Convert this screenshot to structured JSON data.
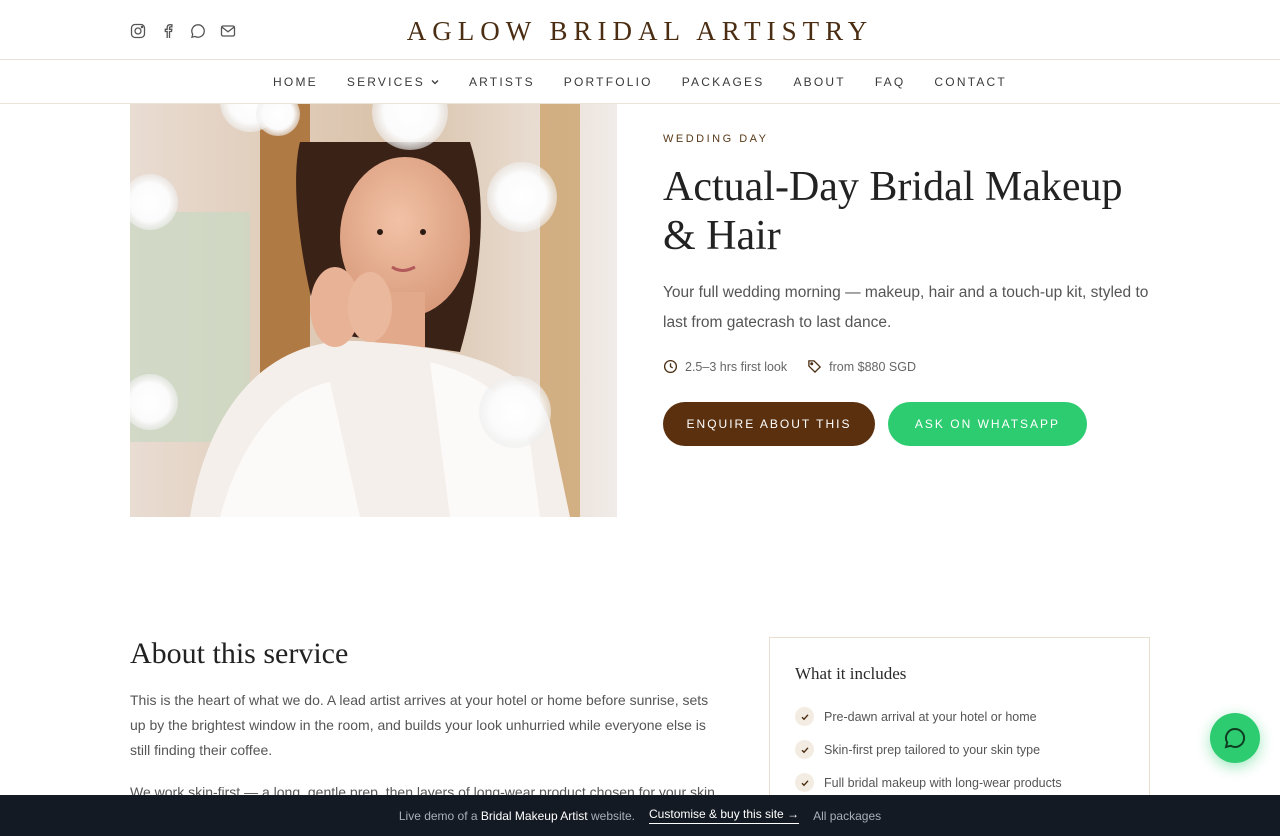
{
  "brand": {
    "name": "AGLOW BRIDAL ARTISTRY"
  },
  "socials": [
    "instagram-icon",
    "facebook-icon",
    "whatsapp-icon",
    "mail-icon"
  ],
  "nav": {
    "items": [
      {
        "label": "HOME"
      },
      {
        "label": "SERVICES"
      },
      {
        "label": "ARTISTS"
      },
      {
        "label": "PORTFOLIO"
      },
      {
        "label": "PACKAGES"
      },
      {
        "label": "ABOUT"
      },
      {
        "label": "FAQ"
      },
      {
        "label": "CONTACT"
      }
    ]
  },
  "hero": {
    "eyebrow": "WEDDING DAY",
    "title": "Actual-Day Bridal Makeup & Hair",
    "description": "Your full wedding morning — makeup, hair and a touch-up kit, styled to last from gatecrash to last dance.",
    "duration": "2.5–3 hrs first look",
    "price": "from $880 SGD",
    "enquire_label": "ENQUIRE ABOUT THIS",
    "whatsapp_label": "ASK ON WHATSAPP"
  },
  "about": {
    "heading": "About this service",
    "p1": "This is the heart of what we do. A lead artist arrives at your hotel or home before sunrise, sets up by the brightest window in the room, and builds your look unhurried while everyone else is still finding their coffee.",
    "p2": "We work skin-first — a long, gentle prep, then layers of long-wear product chosen for your skin type"
  },
  "includes": {
    "heading": "What it includes",
    "items": [
      "Pre-dawn arrival at your hotel or home",
      "Skin-first prep tailored to your skin type",
      "Full bridal makeup with long-wear products"
    ]
  },
  "demo_bar": {
    "prefix": "Live demo of a",
    "site_type": "Bridal Makeup Artist",
    "suffix": "website.",
    "customise_label": "Customise & buy this site →",
    "packages_label": "All packages"
  },
  "colors": {
    "brand_brown": "#5a300f",
    "whatsapp_green": "#2ecc71",
    "demo_bar_bg": "#141a23"
  }
}
